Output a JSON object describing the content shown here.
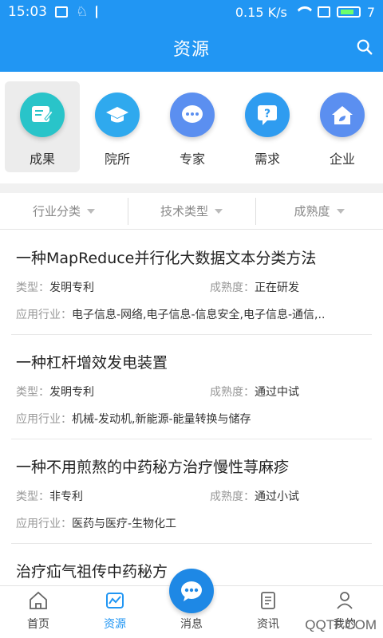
{
  "status": {
    "time": "15:03",
    "speed": "0.15 K/s",
    "battery": "7"
  },
  "header": {
    "title": "资源"
  },
  "categories": [
    {
      "label": "成果",
      "icon": "edit-doc-icon"
    },
    {
      "label": "院所",
      "icon": "graduation-cap-icon"
    },
    {
      "label": "专家",
      "icon": "chat-bubble-icon"
    },
    {
      "label": "需求",
      "icon": "question-bubble-icon"
    },
    {
      "label": "企业",
      "icon": "house-icon"
    }
  ],
  "filters": [
    {
      "label": "行业分类"
    },
    {
      "label": "技术类型"
    },
    {
      "label": "成熟度"
    }
  ],
  "labels": {
    "type": "类型：",
    "maturity": "成熟度：",
    "industry": "应用行业："
  },
  "items": [
    {
      "title": "一种MapReduce并行化大数据文本分类方法",
      "type": "发明专利",
      "maturity": "正在研发",
      "industry": "电子信息-网络,电子信息-信息安全,电子信息-通信,.."
    },
    {
      "title": "一种杠杆增效发电装置",
      "type": "发明专利",
      "maturity": "通过中试",
      "industry": "机械-发动机,新能源-能量转换与储存"
    },
    {
      "title": "一种不用煎熬的中药秘方治疗慢性荨麻疹",
      "type": "非专利",
      "maturity": "通过小试",
      "industry": "医药与医疗-生物化工"
    },
    {
      "title": "治疗疝气祖传中药秘方"
    }
  ],
  "nav": [
    {
      "label": "首页",
      "icon": "home-icon"
    },
    {
      "label": "资源",
      "icon": "resource-chart-icon"
    },
    {
      "label": "消息",
      "icon": "message-icon"
    },
    {
      "label": "资讯",
      "icon": "news-icon"
    },
    {
      "label": "我的",
      "icon": "user-icon"
    }
  ],
  "watermark": "QQTF.COM",
  "colors": {
    "primary": "#2196F3"
  }
}
